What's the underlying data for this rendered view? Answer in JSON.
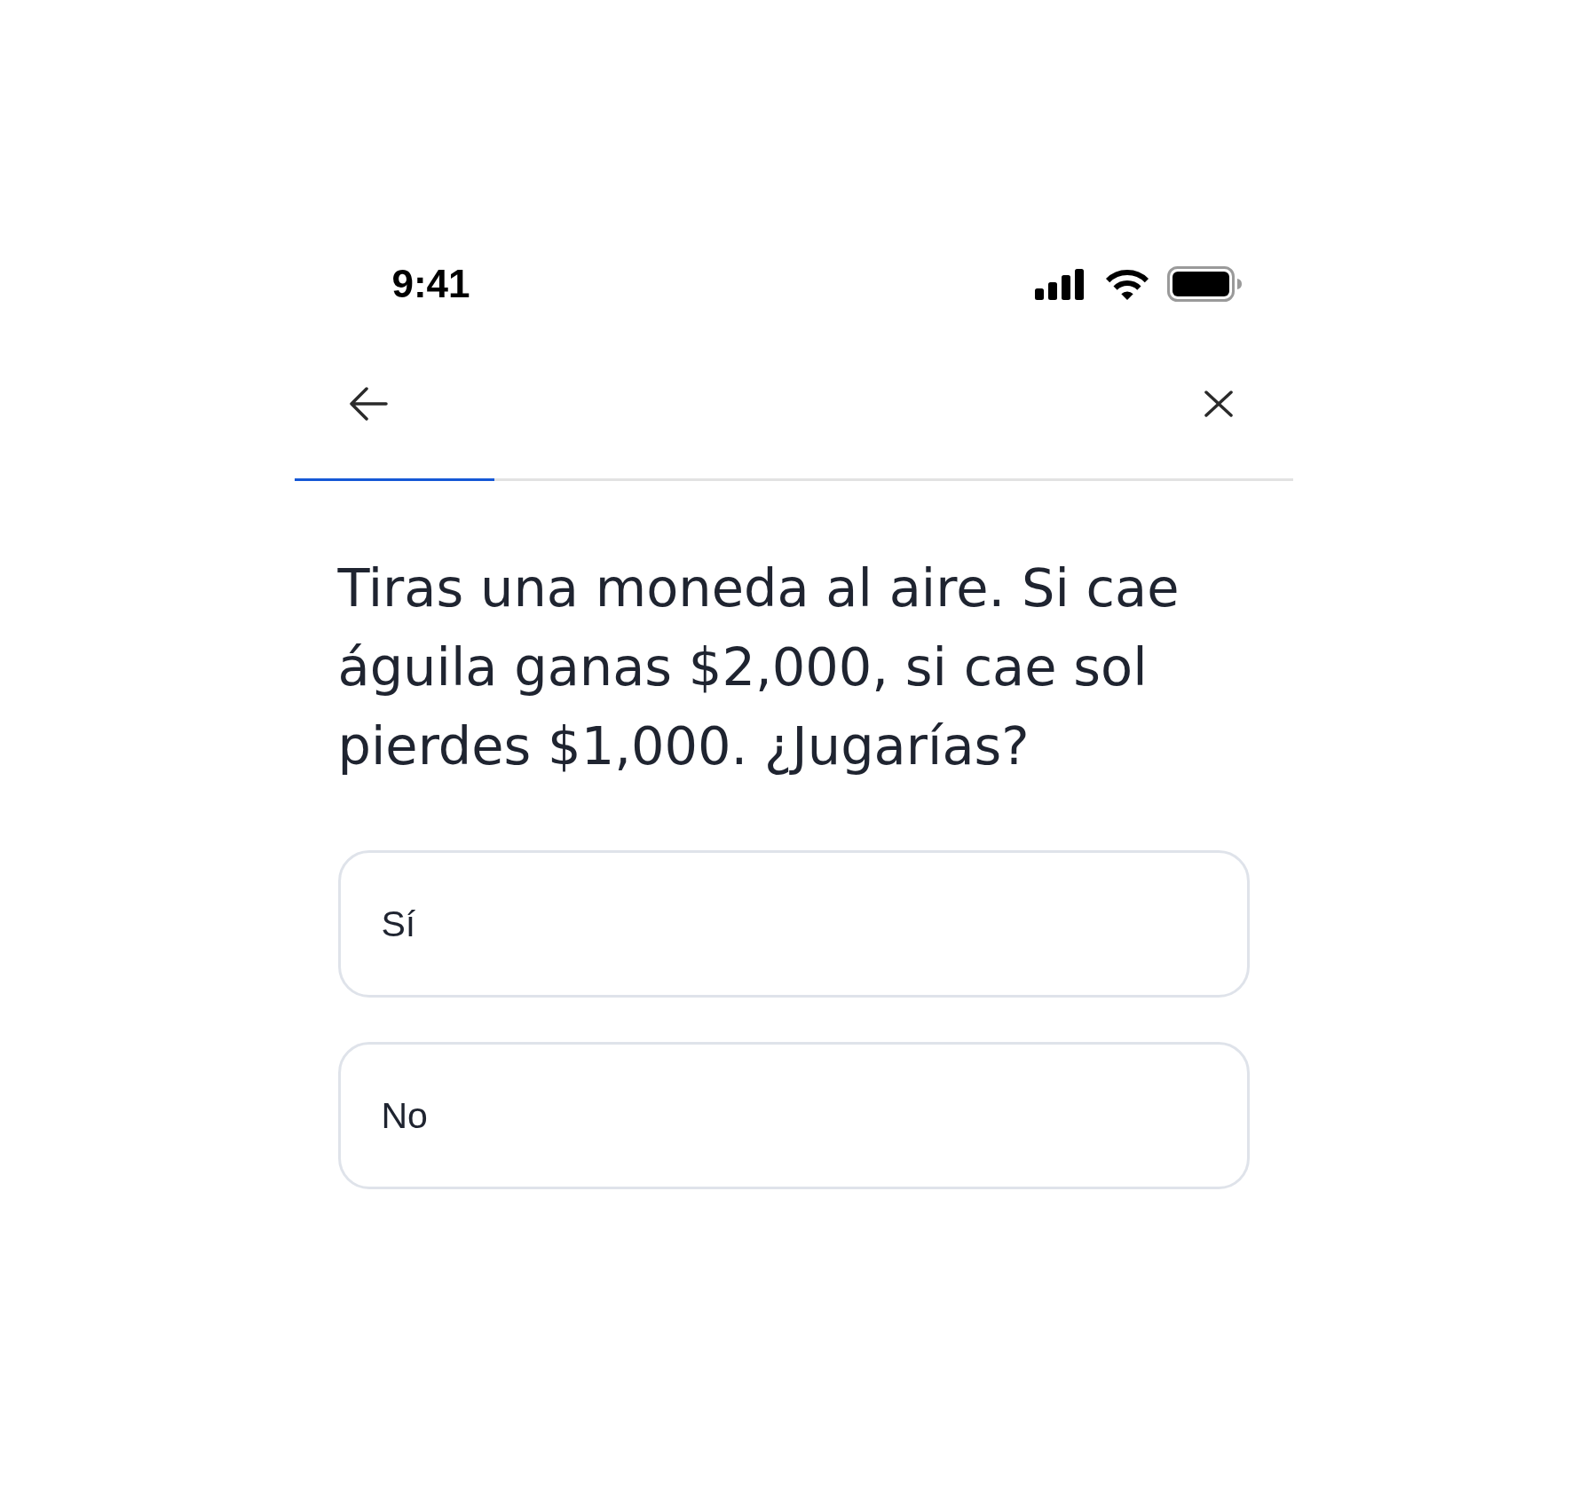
{
  "status_bar": {
    "time": "9:41"
  },
  "progress": {
    "level": 0.2
  },
  "question": "Tiras una moneda al aire. Si cae águila ganas $2,000, si cae sol pierdes $1,000. ¿Jugarías?",
  "options": [
    {
      "label": "Sí",
      "selected": false
    },
    {
      "label": "No",
      "selected": false
    }
  ]
}
